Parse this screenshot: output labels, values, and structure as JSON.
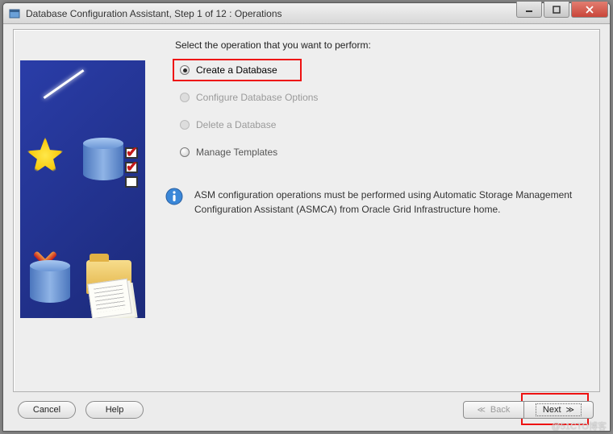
{
  "window": {
    "title": "Database Configuration Assistant, Step 1 of 12 : Operations"
  },
  "prompt": "Select the operation that you want to perform:",
  "options": {
    "create": "Create a Database",
    "configure": "Configure Database Options",
    "delete": "Delete a Database",
    "templates": "Manage Templates"
  },
  "info": {
    "text": "ASM configuration operations must be performed using Automatic Storage Management Configuration Assistant (ASMCA) from Oracle Grid Infrastructure home."
  },
  "buttons": {
    "cancel": "Cancel",
    "help": "Help",
    "back": "Back",
    "next": "Next"
  },
  "watermark": "@51CTO博客"
}
